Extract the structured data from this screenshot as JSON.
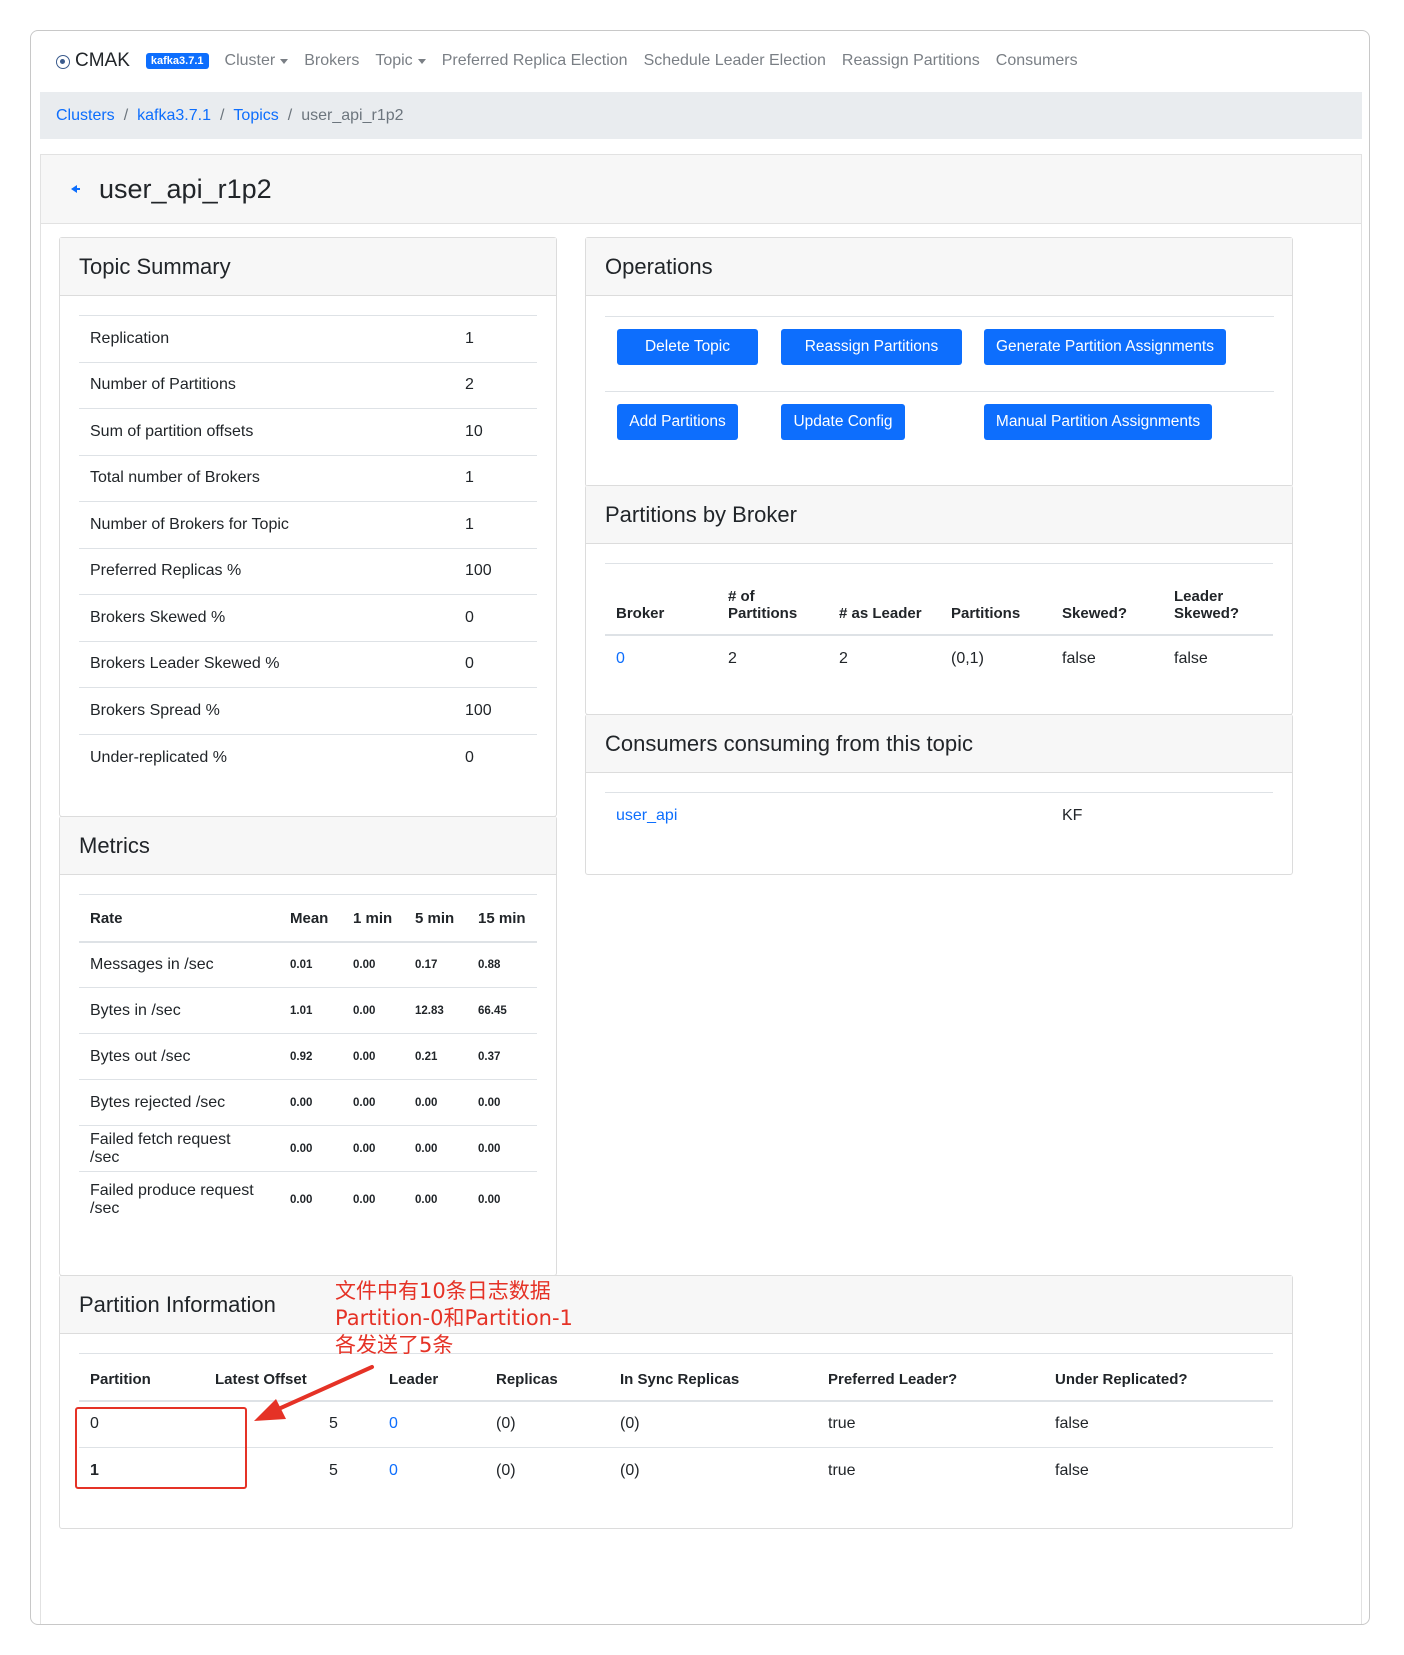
{
  "navbar": {
    "brand": "CMAK",
    "cluster_badge": "kafka3.7.1",
    "items": [
      {
        "label": "Cluster",
        "dropdown": true
      },
      {
        "label": "Brokers",
        "dropdown": false
      },
      {
        "label": "Topic",
        "dropdown": true
      },
      {
        "label": "Preferred Replica Election",
        "dropdown": false
      },
      {
        "label": "Schedule Leader Election",
        "dropdown": false
      },
      {
        "label": "Reassign Partitions",
        "dropdown": false
      },
      {
        "label": "Consumers",
        "dropdown": false
      }
    ]
  },
  "breadcrumb": {
    "clusters": "Clusters",
    "cluster": "kafka3.7.1",
    "topics": "Topics",
    "current": "user_api_r1p2",
    "separator": "/"
  },
  "page": {
    "title": "user_api_r1p2"
  },
  "topic_summary": {
    "title": "Topic Summary",
    "rows": [
      {
        "label": "Replication",
        "value": "1"
      },
      {
        "label": "Number of Partitions",
        "value": "2"
      },
      {
        "label": "Sum of partition offsets",
        "value": "10"
      },
      {
        "label": "Total number of Brokers",
        "value": "1"
      },
      {
        "label": "Number of Brokers for Topic",
        "value": "1"
      },
      {
        "label": "Preferred Replicas %",
        "value": "100"
      },
      {
        "label": "Brokers Skewed %",
        "value": "0"
      },
      {
        "label": "Brokers Leader Skewed %",
        "value": "0"
      },
      {
        "label": "Brokers Spread %",
        "value": "100"
      },
      {
        "label": "Under-replicated %",
        "value": "0"
      }
    ]
  },
  "metrics": {
    "title": "Metrics",
    "headers": [
      "Rate",
      "Mean",
      "1 min",
      "5 min",
      "15 min"
    ],
    "rows": [
      {
        "rate": "Messages in /sec",
        "mean": "0.01",
        "m1": "0.00",
        "m5": "0.17",
        "m15": "0.88"
      },
      {
        "rate": "Bytes in /sec",
        "mean": "1.01",
        "m1": "0.00",
        "m5": "12.83",
        "m15": "66.45"
      },
      {
        "rate": "Bytes out /sec",
        "mean": "0.92",
        "m1": "0.00",
        "m5": "0.21",
        "m15": "0.37"
      },
      {
        "rate": "Bytes rejected /sec",
        "mean": "0.00",
        "m1": "0.00",
        "m5": "0.00",
        "m15": "0.00"
      },
      {
        "rate": "Failed fetch request /sec",
        "mean": "0.00",
        "m1": "0.00",
        "m5": "0.00",
        "m15": "0.00"
      },
      {
        "rate": "Failed produce request /sec",
        "mean": "0.00",
        "m1": "0.00",
        "m5": "0.00",
        "m15": "0.00"
      }
    ]
  },
  "operations": {
    "title": "Operations",
    "delete_topic": "Delete Topic",
    "reassign_partitions": "Reassign Partitions",
    "generate_assignments": "Generate Partition Assignments",
    "add_partitions": "Add Partitions",
    "update_config": "Update Config",
    "manual_assignments": "Manual Partition Assignments"
  },
  "partitions_by_broker": {
    "title": "Partitions by Broker",
    "headers": {
      "broker": "Broker",
      "num_of_1": "# of",
      "num_of_2": "Partitions",
      "as_leader": "# as Leader",
      "partitions": "Partitions",
      "skewed": "Skewed?",
      "leader_1": "Leader",
      "leader_2": "Skewed?"
    },
    "rows": [
      {
        "broker": "0",
        "num": "2",
        "leader": "2",
        "partitions": "(0,1)",
        "skewed": "false",
        "leader_skewed": "false"
      }
    ]
  },
  "consumers": {
    "title": "Consumers consuming from this topic",
    "rows": [
      {
        "name": "user_api",
        "type": "KF"
      }
    ]
  },
  "partition_info": {
    "title": "Partition Information",
    "headers": [
      "Partition",
      "Latest Offset",
      "Leader",
      "Replicas",
      "In Sync Replicas",
      "Preferred Leader?",
      "Under Replicated?"
    ],
    "rows": [
      {
        "partition": "0",
        "offset": "5",
        "leader": "0",
        "replicas": "(0)",
        "isr": "(0)",
        "preferred": "true",
        "under": "false"
      },
      {
        "partition": "1",
        "offset": "5",
        "leader": "0",
        "replicas": "(0)",
        "isr": "(0)",
        "preferred": "true",
        "under": "false"
      }
    ]
  },
  "annotation": {
    "line1": "文件中有10条日志数据",
    "line2": "Partition-0和Partition-1",
    "line3": "各发送了5条",
    "color": "#e53226"
  }
}
